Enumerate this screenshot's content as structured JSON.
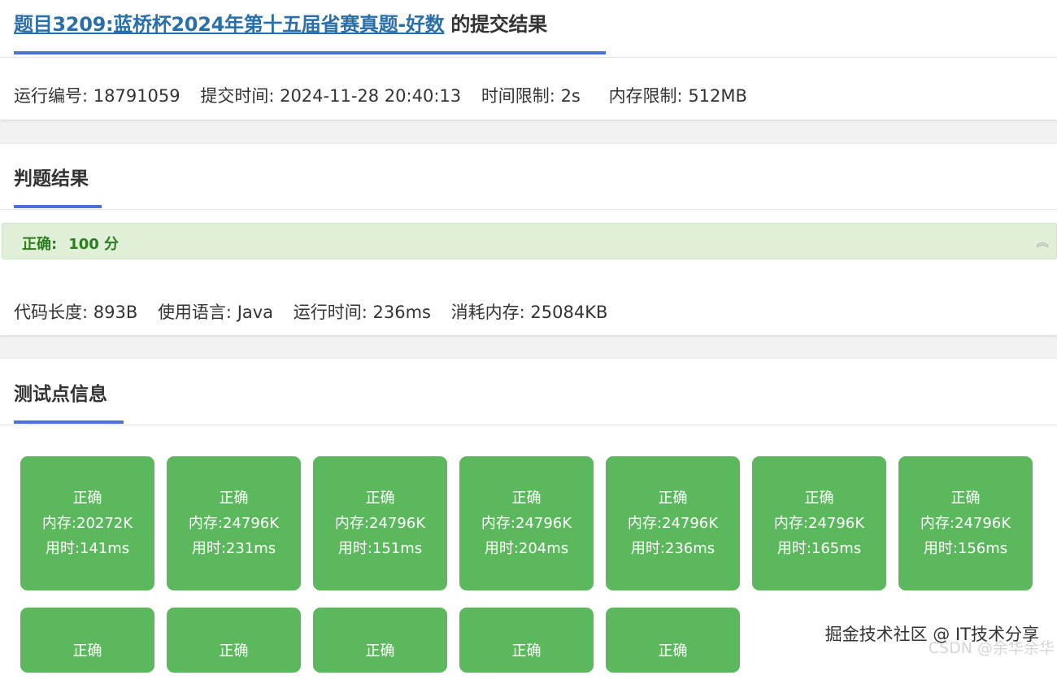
{
  "header": {
    "problem_link": "题目3209:蓝桥杯2024年第十五届省赛真题-好数",
    "title_suffix": "的提交结果"
  },
  "meta": {
    "run_id": "运行编号: 18791059",
    "submit_time": "提交时间: 2024-11-28 20:40:13",
    "time_limit": "时间限制: 2s",
    "memory_limit": "内存限制: 512MB"
  },
  "result": {
    "section_title": "判题结果",
    "verdict_label": "正确:",
    "score": "100 分",
    "code_length": "代码长度: 893B",
    "language": "使用语言: Java",
    "run_time": "运行时间: 236ms",
    "memory_used": "消耗内存: 25084KB"
  },
  "tests": {
    "section_title": "测试点信息",
    "items": [
      {
        "status": "正确",
        "memory": "内存:20272K",
        "time": "用时:141ms"
      },
      {
        "status": "正确",
        "memory": "内存:24796K",
        "time": "用时:231ms"
      },
      {
        "status": "正确",
        "memory": "内存:24796K",
        "time": "用时:151ms"
      },
      {
        "status": "正确",
        "memory": "内存:24796K",
        "time": "用时:204ms"
      },
      {
        "status": "正确",
        "memory": "内存:24796K",
        "time": "用时:236ms"
      },
      {
        "status": "正确",
        "memory": "内存:24796K",
        "time": "用时:165ms"
      },
      {
        "status": "正确",
        "memory": "内存:24796K",
        "time": "用时:156ms"
      },
      {
        "status": "正确"
      },
      {
        "status": "正确"
      },
      {
        "status": "正确"
      },
      {
        "status": "正确"
      },
      {
        "status": "正确"
      }
    ]
  },
  "watermark": {
    "primary": "掘金技术社区 @ IT技术分享",
    "secondary": "CSDN @余华余华"
  },
  "colors": {
    "accent": "#4a72d8",
    "success_box": "#5cb85c",
    "verdict_bg": "#dfefd8",
    "verdict_text": "#2a7e1e",
    "link": "#2a6fa8"
  },
  "icons": {
    "collapse": "double-chevron-up-icon"
  }
}
